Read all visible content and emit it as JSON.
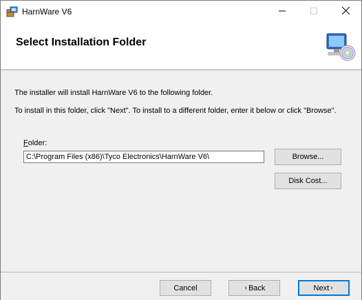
{
  "window": {
    "title": "HarnWare V6"
  },
  "banner": {
    "title": "Select Installation Folder",
    "icon": "computer-with-disc-icon"
  },
  "content": {
    "line1": "The installer will install HarnWare V6 to the following folder.",
    "line2": "To install in this folder, click \"Next\". To install to a different folder, enter it below or click \"Browse\".",
    "folder_label_mnemonic": "F",
    "folder_label_rest": "older:",
    "folder_value": "C:\\Program Files (x86)\\Tyco Electronics\\HarnWare V6\\",
    "browse_label": "Browse...",
    "disk_cost_label": "Disk Cost..."
  },
  "footer": {
    "cancel_label": "Cancel",
    "back_label": "Back",
    "back_chevron": "‹",
    "next_label": "Next",
    "next_chevron": "›"
  },
  "colors": {
    "accent": "#0078d7",
    "panel": "#f0f0f0",
    "button": "#e1e1e1"
  }
}
